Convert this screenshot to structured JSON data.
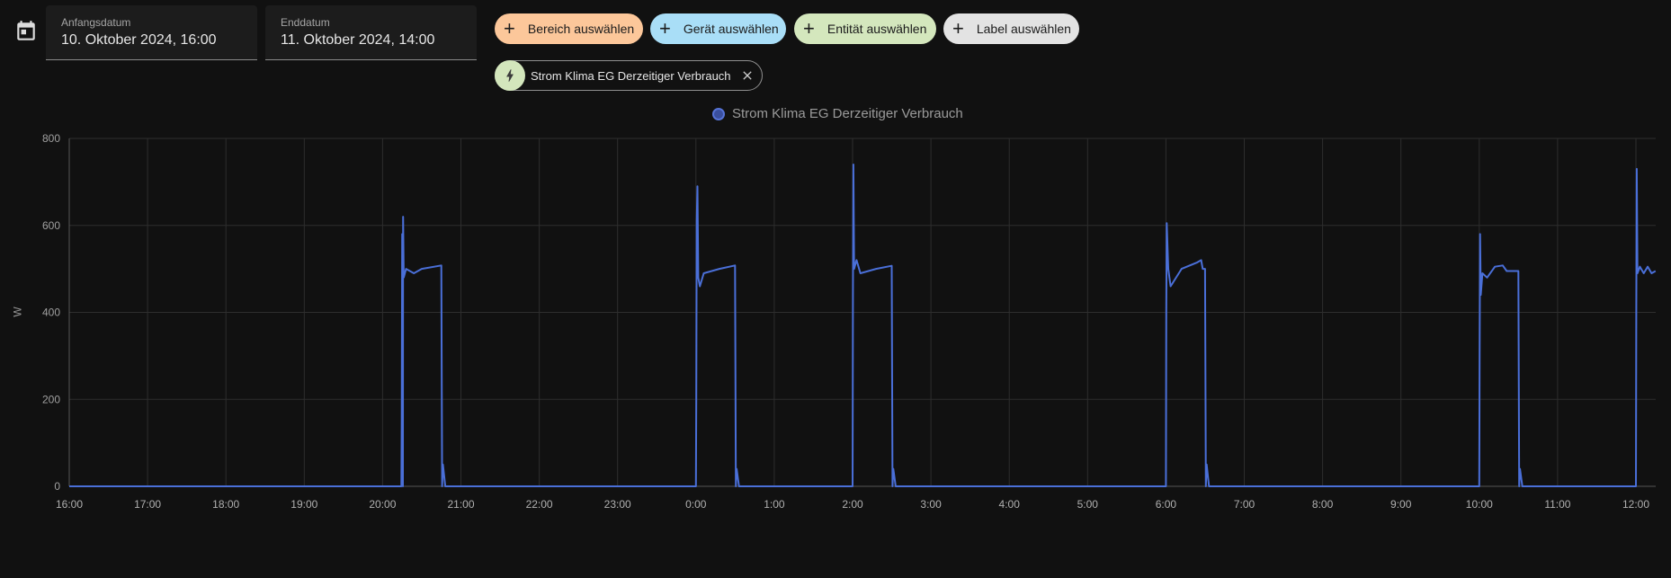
{
  "date_range": {
    "start_label": "Anfangsdatum",
    "start_value": "10. Oktober 2024, 16:00",
    "end_label": "Enddatum",
    "end_value": "11. Oktober 2024, 14:00"
  },
  "filters": [
    {
      "label": "Bereich auswählen",
      "color": "#fcc79a"
    },
    {
      "label": "Gerät auswählen",
      "color": "#a9def7"
    },
    {
      "label": "Entität auswählen",
      "color": "#d4e7bd"
    },
    {
      "label": "Label auswählen",
      "color": "#e3e3e3"
    }
  ],
  "selected_entity": {
    "label": "Strom Klima EG Derzeitiger Verbrauch",
    "icon": "lightning-icon"
  },
  "legend": {
    "label": "Strom Klima EG Derzeitiger Verbrauch"
  },
  "chart_data": {
    "type": "line",
    "ylabel": "W",
    "ylim": [
      0,
      800
    ],
    "yticks": [
      0,
      200,
      400,
      600,
      800
    ],
    "xticks": [
      "16:00",
      "17:00",
      "18:00",
      "19:00",
      "20:00",
      "21:00",
      "22:00",
      "23:00",
      "0:00",
      "1:00",
      "2:00",
      "3:00",
      "4:00",
      "5:00",
      "6:00",
      "7:00",
      "8:00",
      "9:00",
      "10:00",
      "11:00",
      "12:00"
    ],
    "xlim_hours": [
      0,
      20.25
    ],
    "series_color": "#4a6fd8",
    "series": [
      {
        "name": "Strom Klima EG Derzeitiger Verbrauch",
        "points": [
          [
            0,
            0
          ],
          [
            4.24,
            0
          ],
          [
            4.245,
            150
          ],
          [
            4.25,
            580
          ],
          [
            4.26,
            0
          ],
          [
            4.262,
            620
          ],
          [
            4.27,
            480
          ],
          [
            4.3,
            500
          ],
          [
            4.4,
            490
          ],
          [
            4.5,
            500
          ],
          [
            4.75,
            508
          ],
          [
            4.76,
            0
          ],
          [
            4.77,
            50
          ],
          [
            4.8,
            0
          ],
          [
            8.0,
            0
          ],
          [
            8.005,
            200
          ],
          [
            8.01,
            610
          ],
          [
            8.02,
            690
          ],
          [
            8.03,
            480
          ],
          [
            8.05,
            460
          ],
          [
            8.1,
            490
          ],
          [
            8.3,
            500
          ],
          [
            8.5,
            508
          ],
          [
            8.51,
            0
          ],
          [
            8.52,
            40
          ],
          [
            8.55,
            0
          ],
          [
            10.0,
            0
          ],
          [
            10.005,
            450
          ],
          [
            10.01,
            740
          ],
          [
            10.02,
            500
          ],
          [
            10.05,
            520
          ],
          [
            10.1,
            490
          ],
          [
            10.3,
            500
          ],
          [
            10.5,
            507
          ],
          [
            10.51,
            0
          ],
          [
            10.52,
            40
          ],
          [
            10.55,
            0
          ],
          [
            14.0,
            0
          ],
          [
            14.005,
            400
          ],
          [
            14.01,
            605
          ],
          [
            14.03,
            500
          ],
          [
            14.06,
            460
          ],
          [
            14.2,
            500
          ],
          [
            14.4,
            515
          ],
          [
            14.45,
            520
          ],
          [
            14.47,
            500
          ],
          [
            14.5,
            500
          ],
          [
            14.51,
            0
          ],
          [
            14.52,
            50
          ],
          [
            14.55,
            0
          ],
          [
            18.0,
            0
          ],
          [
            18.005,
            300
          ],
          [
            18.01,
            580
          ],
          [
            18.02,
            440
          ],
          [
            18.04,
            490
          ],
          [
            18.1,
            480
          ],
          [
            18.2,
            505
          ],
          [
            18.3,
            508
          ],
          [
            18.35,
            495
          ],
          [
            18.5,
            495
          ],
          [
            18.51,
            0
          ],
          [
            18.52,
            40
          ],
          [
            18.55,
            0
          ],
          [
            20.0,
            0
          ],
          [
            20.005,
            400
          ],
          [
            20.01,
            730
          ],
          [
            20.02,
            490
          ],
          [
            20.05,
            505
          ],
          [
            20.1,
            490
          ],
          [
            20.15,
            505
          ],
          [
            20.2,
            490
          ],
          [
            20.25,
            495
          ]
        ]
      }
    ]
  }
}
